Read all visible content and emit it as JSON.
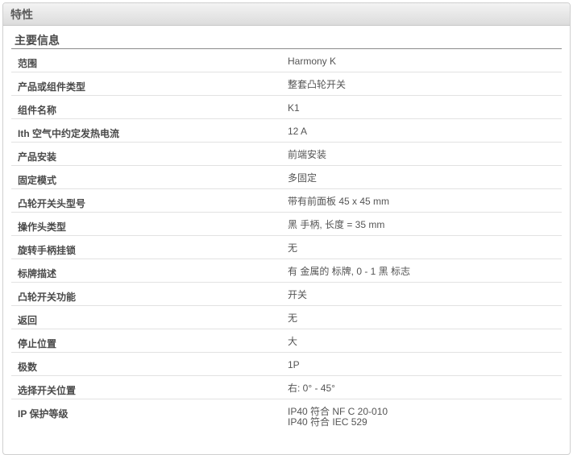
{
  "panel": {
    "title": "特性"
  },
  "section": {
    "title": "主要信息"
  },
  "rows": [
    {
      "label": "范围",
      "value": "Harmony K"
    },
    {
      "label": "产品或组件类型",
      "value": "整套凸轮开关"
    },
    {
      "label": "组件名称",
      "value": "K1"
    },
    {
      "label": "Ith 空气中约定发热电流",
      "value": "12 A"
    },
    {
      "label": "产品安装",
      "value": "前端安装"
    },
    {
      "label": "固定模式",
      "value": "多固定"
    },
    {
      "label": "凸轮开关头型号",
      "value": "带有前面板 45 x 45 mm"
    },
    {
      "label": "操作头类型",
      "value": "黑 手柄, 长度 = 35 mm"
    },
    {
      "label": "旋转手柄挂锁",
      "value": "无"
    },
    {
      "label": "标牌描述",
      "value": "有 金属的 标牌, 0 - 1 黑 标志"
    },
    {
      "label": "凸轮开关功能",
      "value": "开关"
    },
    {
      "label": "返回",
      "value": "无"
    },
    {
      "label": "停止位置",
      "value": "大"
    },
    {
      "label": "极数",
      "value": "1P"
    },
    {
      "label": "选择开关位置",
      "value": "右: 0° - 45°"
    },
    {
      "label": "IP 保护等级",
      "value_lines": [
        "IP40 符合 NF C 20-010",
        "IP40 符合 IEC 529"
      ]
    }
  ]
}
